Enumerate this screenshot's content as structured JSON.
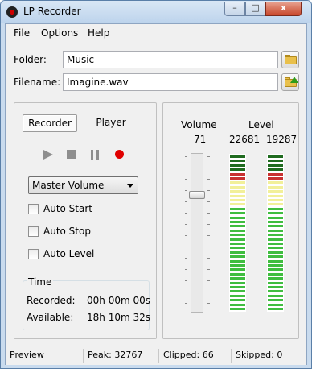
{
  "window": {
    "title": "LP Recorder",
    "min": "–",
    "max": "□",
    "close": "x"
  },
  "menu": [
    "File",
    "Options",
    "Help"
  ],
  "folder": {
    "label": "Folder:",
    "value": "Music"
  },
  "filename": {
    "label": "Filename:",
    "value": "Imagine.wav"
  },
  "tabs": [
    "Recorder",
    "Player"
  ],
  "source_select": "Master Volume",
  "checkboxes": [
    "Auto Start",
    "Auto Stop",
    "Auto Level"
  ],
  "time": {
    "title": "Time",
    "rows": [
      {
        "label": "Recorded:",
        "value": "00h 00m 00s"
      },
      {
        "label": "Available:",
        "value": "18h 10m 32s"
      }
    ]
  },
  "volume": {
    "label": "Volume",
    "value": "71",
    "fraction": 0.71
  },
  "level": {
    "label": "Level",
    "left": "22681",
    "right": "19287"
  },
  "status": {
    "mode": "Preview",
    "peak": "Peak: 32767",
    "clipped": "Clipped: 66",
    "skipped": "Skipped: 0"
  },
  "colors": {
    "accent": "#e00000",
    "meter_green": "#3fbd3f",
    "meter_yellow": "#f2f09a",
    "meter_red": "#c83030",
    "meter_dark": "#1f6b1f"
  },
  "icons": {
    "folder": "folder-icon",
    "save_folder": "folder-save-icon"
  }
}
